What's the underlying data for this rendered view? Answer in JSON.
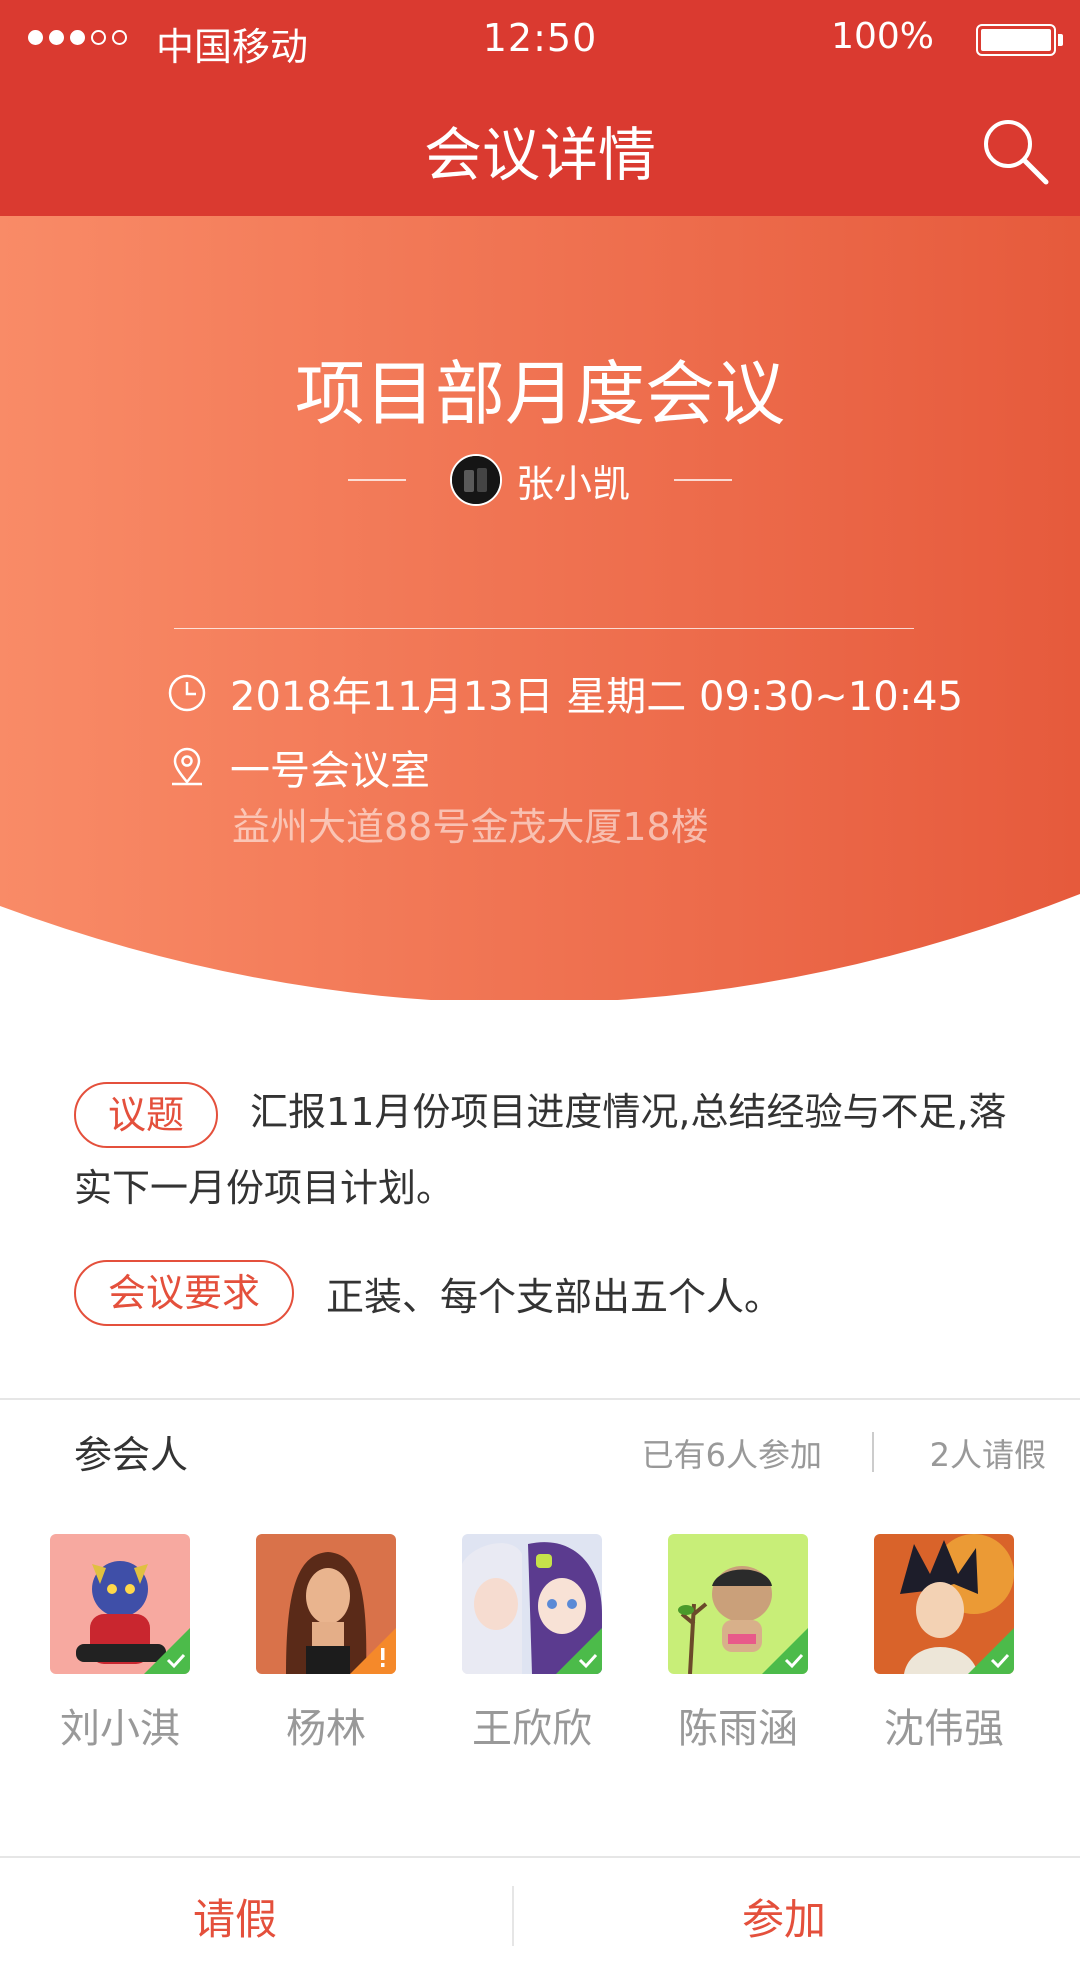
{
  "status_bar": {
    "carrier": "中国移动",
    "time": "12:50",
    "battery": "100%"
  },
  "nav": {
    "title": "会议详情"
  },
  "meeting": {
    "title": "项目部月度会议",
    "host": "张小凯",
    "datetime": "2018年11月13日  星期二 09:30~10:45",
    "room": "一号会议室",
    "address": "益州大道88号金茂大厦18楼"
  },
  "agenda": {
    "tag": "议题",
    "text": "汇报11月份项目进度情况,总结经验与不足,落实下一月份项目计划。"
  },
  "requirement": {
    "tag": "会议要求",
    "text": "正装、每个支部出五个人。"
  },
  "attendees": {
    "title": "参会人",
    "joined": "已有6人参加",
    "leave": "2人请假",
    "people": [
      {
        "name": "刘小淇",
        "status": "joined"
      },
      {
        "name": "杨林",
        "status": "leave"
      },
      {
        "name": "王欣欣",
        "status": "joined"
      },
      {
        "name": "陈雨涵",
        "status": "joined"
      },
      {
        "name": "沈伟强",
        "status": "joined"
      }
    ]
  },
  "actions": {
    "leave_label": "请假",
    "join_label": "参加"
  },
  "colors": {
    "primary": "#da3a30",
    "accent": "#e4503c",
    "joined_badge": "#4cbb4a",
    "leave_badge": "#f5892a"
  }
}
